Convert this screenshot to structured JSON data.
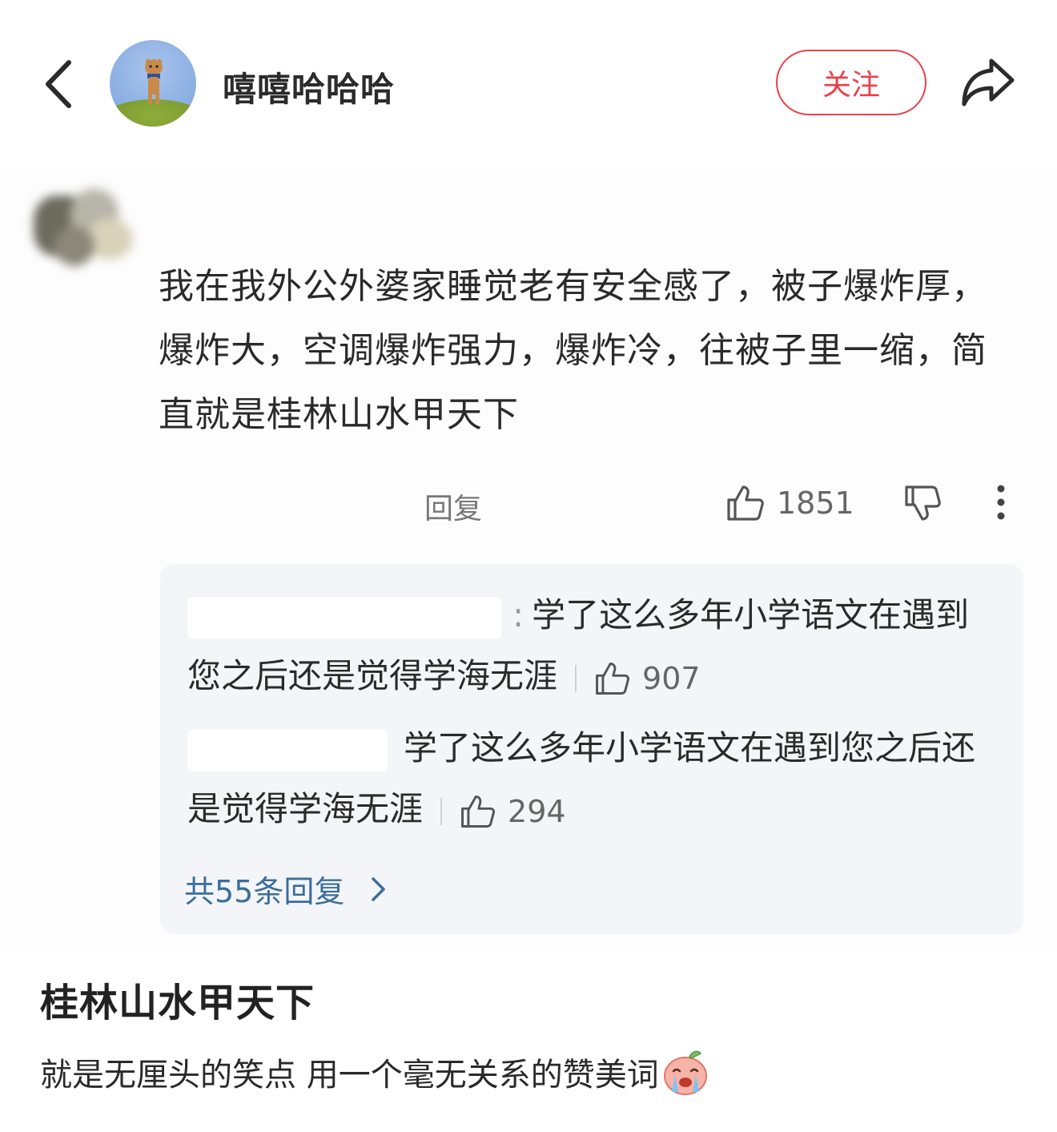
{
  "header": {
    "username": "嘻嘻哈哈哈",
    "follow_label": "关注"
  },
  "comment": {
    "text": "我在我外公外婆家睡觉老有安全感了，被子爆炸厚，爆炸大，空调爆炸强力，爆炸冷，往被子里一缩，简直就是桂林山水甲天下",
    "reply_label": "回复",
    "like_count": "1851",
    "replies": [
      {
        "separator": ":",
        "text": "学了这么多年小学语文在遇到您之后还是觉得学海无涯",
        "like_count": "907"
      },
      {
        "separator": "",
        "text": "学了这么多年小学语文在遇到您之后还是觉得学海无涯",
        "like_count": "294"
      }
    ],
    "all_replies_label": "共55条回复"
  },
  "post": {
    "title": "桂林山水甲天下",
    "body": "就是无厘头的笑点 用一个毫无关系的赞美词"
  },
  "colors": {
    "accent": "#e8414b",
    "link": "#3b6e9c",
    "reply_bg": "#f4f5f8"
  }
}
